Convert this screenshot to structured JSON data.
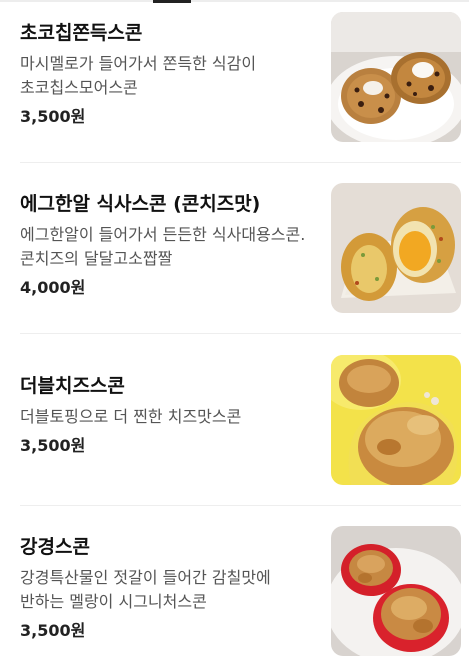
{
  "menu": {
    "items": [
      {
        "name": "초코칩쫀득스콘",
        "description": "마시멜로가 들어가서 쫀득한 식감이 초코칩스모어스콘",
        "price": "3,500원",
        "image": "choco-chip-scone-photo"
      },
      {
        "name": "에그한알 식사스콘 (콘치즈맛)",
        "description": "에그한알이 들어가서 든든한 식사대용스콘. 콘치즈의 달달고소짭짤",
        "price": "4,000원",
        "image": "egg-scone-photo"
      },
      {
        "name": "더블치즈스콘",
        "description": "더블토핑으로 더 찐한 치즈맛스콘",
        "price": "3,500원",
        "image": "double-cheese-scone-photo"
      },
      {
        "name": "강경스콘",
        "description": "강경특산물인 젓갈이 들어간 감칠맛에 반하는 멜랑이 시그니처스콘",
        "price": "3,500원",
        "image": "ganggyeong-scone-photo"
      }
    ]
  },
  "colors": {
    "title": "#111111",
    "description": "#555555",
    "price": "#222222",
    "divider": "#eeeeee"
  }
}
